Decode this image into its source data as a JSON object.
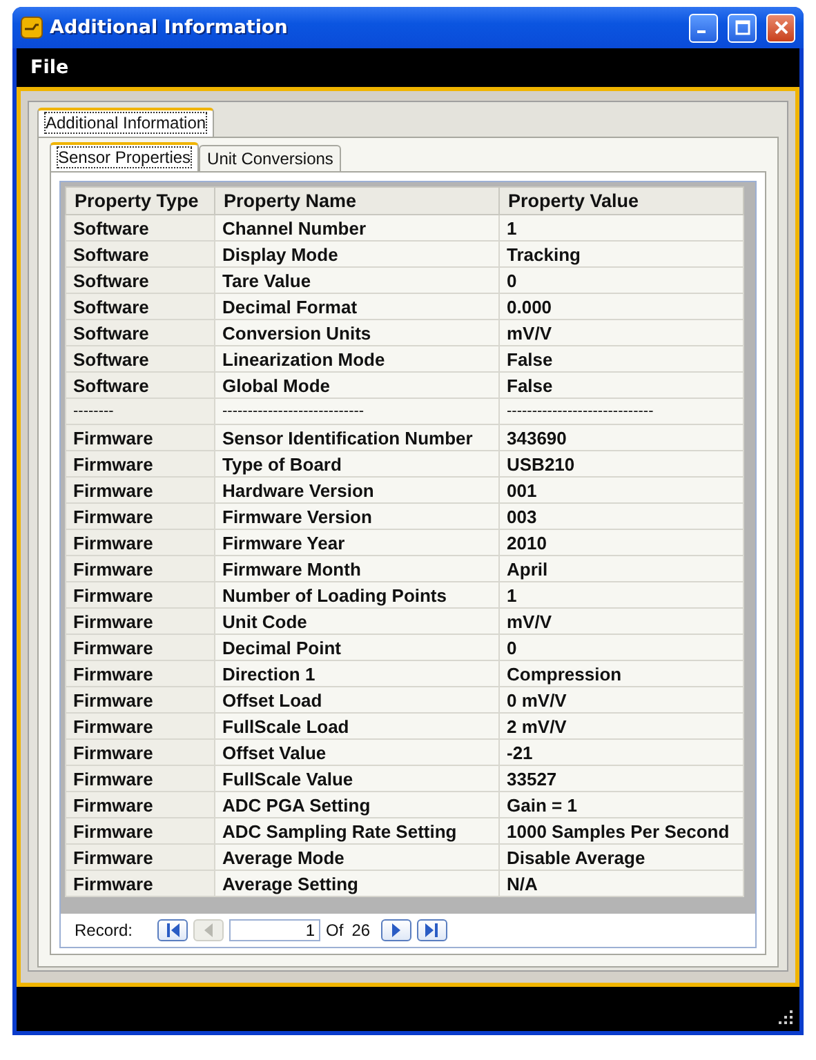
{
  "window": {
    "title": "Additional Information"
  },
  "menu": [
    "File"
  ],
  "outer_tabs": [
    {
      "label": "Additional Information",
      "selected": true
    }
  ],
  "inner_tabs": [
    {
      "label": "Sensor Properties",
      "selected": true
    },
    {
      "label": "Unit Conversions",
      "selected": false
    }
  ],
  "table": {
    "columns": [
      "Property Type",
      "Property Name",
      "Property Value"
    ],
    "rows": [
      [
        "Software",
        "Channel Number",
        "1"
      ],
      [
        "Software",
        "Display Mode",
        "Tracking"
      ],
      [
        "Software",
        "Tare Value",
        "0"
      ],
      [
        "Software",
        "Decimal Format",
        "0.000"
      ],
      [
        "Software",
        "Conversion Units",
        "mV/V"
      ],
      [
        "Software",
        "Linearization Mode",
        "False"
      ],
      [
        "Software",
        "Global Mode",
        "False"
      ],
      [
        "--------",
        "----------------------------",
        "-----------------------------"
      ],
      [
        "Firmware",
        "Sensor Identification Number",
        "343690"
      ],
      [
        "Firmware",
        "Type of Board",
        "USB210"
      ],
      [
        "Firmware",
        "Hardware Version",
        "001"
      ],
      [
        "Firmware",
        "Firmware Version",
        "003"
      ],
      [
        "Firmware",
        "Firmware Year",
        "2010"
      ],
      [
        "Firmware",
        "Firmware Month",
        "April"
      ],
      [
        "Firmware",
        "Number of Loading Points",
        "1"
      ],
      [
        "Firmware",
        "Unit Code",
        "mV/V"
      ],
      [
        "Firmware",
        "Decimal Point",
        "0"
      ],
      [
        "Firmware",
        "Direction 1",
        "Compression"
      ],
      [
        "Firmware",
        "Offset Load",
        "0 mV/V"
      ],
      [
        "Firmware",
        "FullScale Load",
        "2 mV/V"
      ],
      [
        "Firmware",
        "Offset Value",
        "-21"
      ],
      [
        "Firmware",
        "FullScale Value",
        "33527"
      ],
      [
        "Firmware",
        "ADC PGA Setting",
        "Gain = 1"
      ],
      [
        "Firmware",
        "ADC Sampling Rate Setting",
        "1000 Samples Per Second"
      ],
      [
        "Firmware",
        "Average Mode",
        "Disable Average"
      ],
      [
        "Firmware",
        "Average Setting",
        "N/A"
      ]
    ]
  },
  "navigator": {
    "label": "Record:",
    "value": "1",
    "of": "Of",
    "total": "26",
    "buttons": [
      {
        "kind": "first",
        "disabled": false
      },
      {
        "kind": "prev",
        "disabled": true
      },
      {
        "kind": "next",
        "disabled": false
      },
      {
        "kind": "last",
        "disabled": false
      }
    ]
  }
}
